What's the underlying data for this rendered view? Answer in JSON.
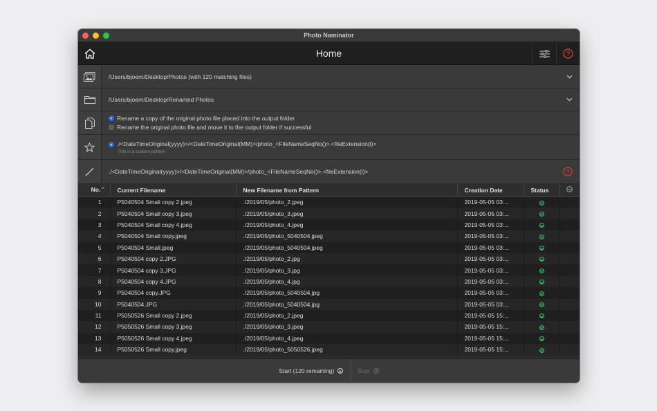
{
  "window": {
    "title": "Photo Naminator"
  },
  "toolbar": {
    "page_title": "Home",
    "home_icon": "home-icon",
    "settings_icon": "sliders-icon",
    "help_icon": "help-icon"
  },
  "source": {
    "path": "/Users/bjoern/Desktop/Photos (with 120 matching files)"
  },
  "output": {
    "path": "/Users/bjoern/Desktop/Renamed Photos"
  },
  "mode": {
    "options": [
      "Rename a copy of the original photo file placed into the output folder",
      "Rename the original photo file and move it to the output folder if successful"
    ],
    "selected": 0
  },
  "preset": {
    "pattern": "./<DateTimeOriginal(yyyy)>/<DateTimeOriginal(MM)>/photo_<FileNameSeqNo()>.<fileExtension(l)>",
    "note": "This is a custom pattern"
  },
  "pattern_input": {
    "value": "./<DateTimeOriginal(yyyy)>/<DateTimeOriginal(MM)>/photo_<FileNameSeqNo()>.<fileExtension(l)>"
  },
  "table": {
    "headers": {
      "no": "No.",
      "current": "Current Filename",
      "new": "New Filename from Pattern",
      "date": "Creation Date",
      "status": "Status"
    },
    "rows": [
      {
        "no": "1",
        "current": "P5040504 Small copy 2.jpeg",
        "new": "./2019/05/photo_2.jpeg",
        "date": "2019-05-05 03:..."
      },
      {
        "no": "2",
        "current": "P5040504 Small copy 3.jpeg",
        "new": "./2019/05/photo_3.jpeg",
        "date": "2019-05-05 03:..."
      },
      {
        "no": "3",
        "current": "P5040504 Small copy 4.jpeg",
        "new": "./2019/05/photo_4.jpeg",
        "date": "2019-05-05 03:..."
      },
      {
        "no": "4",
        "current": "P5040504 Small copy.jpeg",
        "new": "./2019/05/photo_5040504.jpeg",
        "date": "2019-05-05 03:..."
      },
      {
        "no": "5",
        "current": "P5040504 Small.jpeg",
        "new": "./2019/05/photo_5040504.jpeg",
        "date": "2019-05-05 03:..."
      },
      {
        "no": "6",
        "current": "P5040504 copy 2.JPG",
        "new": "./2019/05/photo_2.jpg",
        "date": "2019-05-05 03:..."
      },
      {
        "no": "7",
        "current": "P5040504 copy 3.JPG",
        "new": "./2019/05/photo_3.jpg",
        "date": "2019-05-05 03:..."
      },
      {
        "no": "8",
        "current": "P5040504 copy 4.JPG",
        "new": "./2019/05/photo_4.jpg",
        "date": "2019-05-05 03:..."
      },
      {
        "no": "9",
        "current": "P5040504 copy.JPG",
        "new": "./2019/05/photo_5040504.jpg",
        "date": "2019-05-05 03:..."
      },
      {
        "no": "10",
        "current": "P5040504.JPG",
        "new": "./2019/05/photo_5040504.jpg",
        "date": "2019-05-05 03:..."
      },
      {
        "no": "11",
        "current": "P5050526 Small copy 2.jpeg",
        "new": "./2019/05/photo_2.jpeg",
        "date": "2019-05-05 15:..."
      },
      {
        "no": "12",
        "current": "P5050526 Small copy 3.jpeg",
        "new": "./2019/05/photo_3.jpeg",
        "date": "2019-05-05 15:..."
      },
      {
        "no": "13",
        "current": "P5050526 Small copy 4.jpeg",
        "new": "./2019/05/photo_4.jpeg",
        "date": "2019-05-05 15:..."
      },
      {
        "no": "14",
        "current": "P5050526 Small copy.jpeg",
        "new": "./2019/05/photo_5050526.jpeg",
        "date": "2019-05-05 15:..."
      }
    ]
  },
  "footer": {
    "start_label": "Start (120 remaining)",
    "stop_label": "Stop"
  },
  "colors": {
    "accent": "#2b6fe0",
    "help_red": "#e0443a",
    "status_green": "#3cc46a"
  }
}
